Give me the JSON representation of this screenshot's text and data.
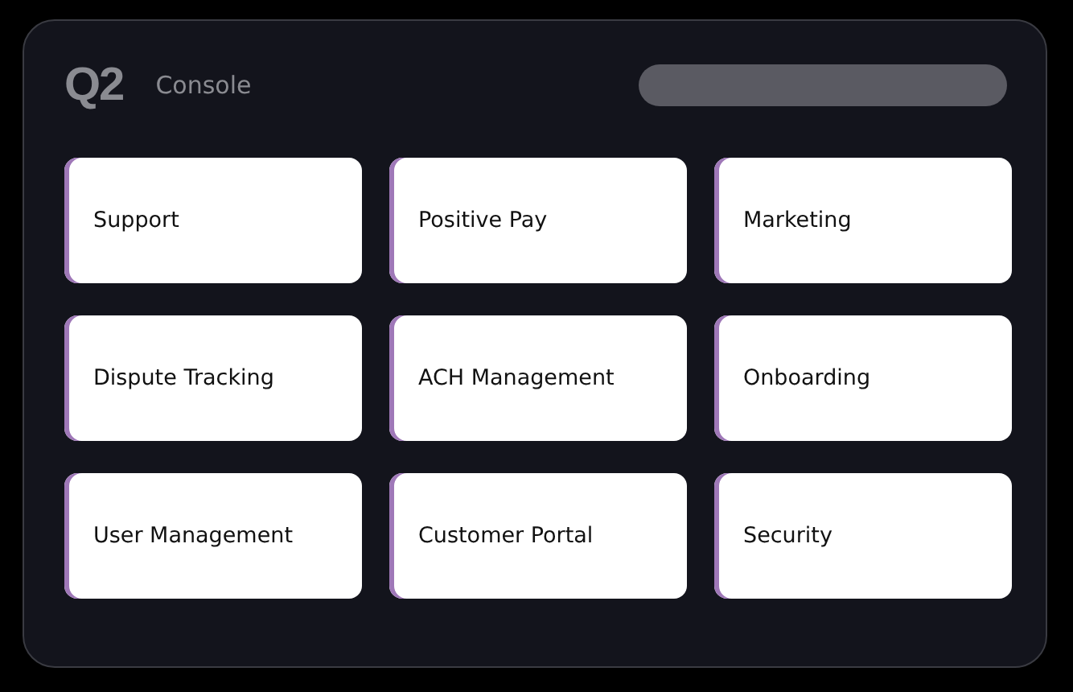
{
  "header": {
    "logo": "Q2",
    "title": "Console"
  },
  "tiles": [
    {
      "label": "Support"
    },
    {
      "label": "Positive Pay"
    },
    {
      "label": "Marketing"
    },
    {
      "label": "Dispute Tracking"
    },
    {
      "label": "ACH Management"
    },
    {
      "label": "Onboarding"
    },
    {
      "label": "User Management"
    },
    {
      "label": "Customer Portal"
    },
    {
      "label": "Security"
    }
  ]
}
